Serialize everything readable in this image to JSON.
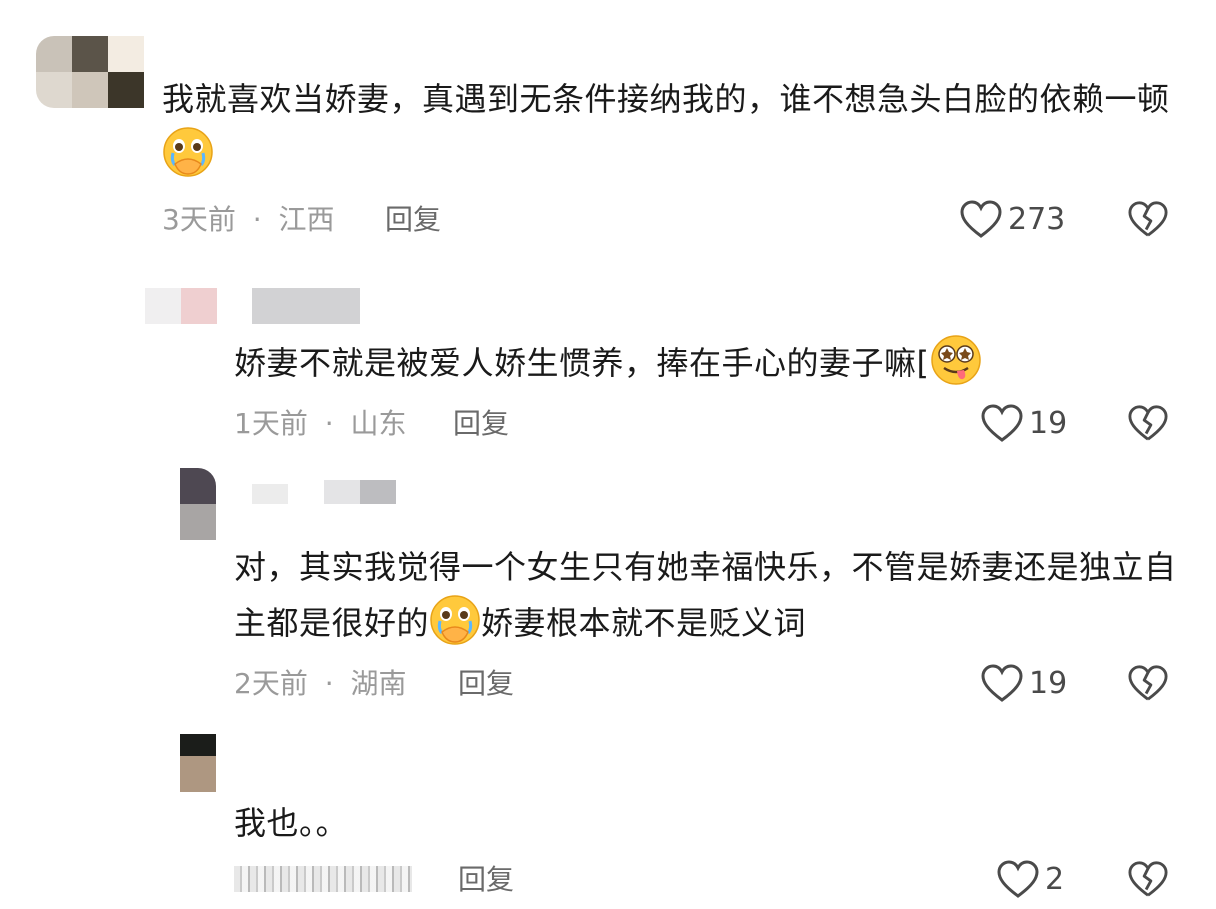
{
  "comments": [
    {
      "text_before_emoji": "我就喜欢当娇妻，真遇到无条件接纳我的，谁不想急头白脸的依赖一顿",
      "text_after_emoji": "",
      "emoji_icon": "crying-hands-over-mouth-emoji",
      "time": "3天前",
      "location": "江西",
      "reply_label": "回复",
      "likes": "273"
    },
    {
      "text_before_emoji": "娇妻不就是被爱人娇生惯养，捧在手心的妻子嘛[",
      "text_after_emoji": "",
      "emoji_icon": "starry-eyed-tongue-emoji",
      "time": "1天前",
      "location": "山东",
      "reply_label": "回复",
      "likes": "19"
    },
    {
      "text_before_emoji": "对，其实我觉得一个女生只有她幸福快乐，不管是娇妻还是独立自主都是很好的",
      "text_after_emoji": "娇妻根本就不是贬义词",
      "emoji_icon": "crying-hands-over-mouth-emoji",
      "time": "2天前",
      "location": "湖南",
      "reply_label": "回复",
      "likes": "19"
    },
    {
      "text_before_emoji": "我也。。",
      "text_after_emoji": "",
      "time": "",
      "location": "",
      "reply_label": "回复",
      "likes": "2"
    }
  ],
  "separator": "·",
  "colors": {
    "text": "#1a1a1a",
    "meta": "#9a9a9a",
    "icon": "#4a4a4a"
  }
}
